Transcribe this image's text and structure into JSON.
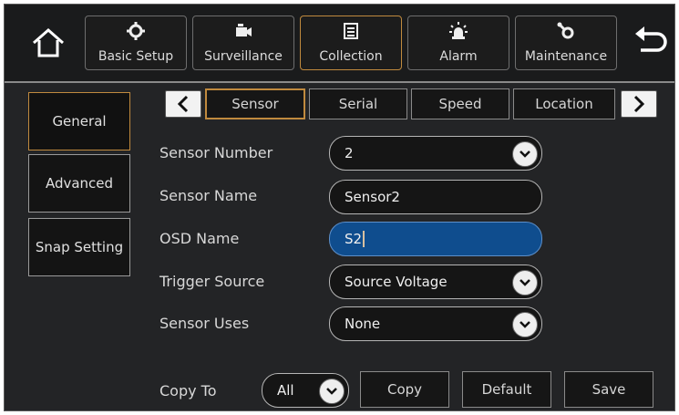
{
  "topnav": {
    "home_icon": "home-icon",
    "back_icon": "back-arrow-icon",
    "items": [
      {
        "label": "Basic Setup",
        "icon": "gear-icon"
      },
      {
        "label": "Surveillance",
        "icon": "camera-icon"
      },
      {
        "label": "Collection",
        "icon": "document-icon",
        "active": true
      },
      {
        "label": "Alarm",
        "icon": "alarm-light-icon"
      },
      {
        "label": "Maintenance",
        "icon": "wrench-gear-icon"
      }
    ]
  },
  "sidebar": {
    "items": [
      {
        "label": "General",
        "active": true
      },
      {
        "label": "Advanced"
      },
      {
        "label": "Snap Setting"
      }
    ]
  },
  "tabs": {
    "items": [
      {
        "label": "Sensor",
        "active": true
      },
      {
        "label": "Serial"
      },
      {
        "label": "Speed"
      },
      {
        "label": "Location"
      }
    ]
  },
  "form": {
    "sensor_number": {
      "label": "Sensor Number",
      "value": "2"
    },
    "sensor_name": {
      "label": "Sensor Name",
      "value": "Sensor2"
    },
    "osd_name": {
      "label": "OSD Name",
      "value": "S2"
    },
    "trigger_source": {
      "label": "Trigger Source",
      "value": "Source Voltage"
    },
    "sensor_uses": {
      "label": "Sensor Uses",
      "value": "None"
    }
  },
  "footer": {
    "copy_to_label": "Copy To",
    "copy_to_value": "All",
    "copy_button": "Copy",
    "default_button": "Default",
    "save_button": "Save"
  },
  "colors": {
    "background": "#232426",
    "accent_border": "#c08a3e",
    "active_field": "#0f4d8e"
  }
}
